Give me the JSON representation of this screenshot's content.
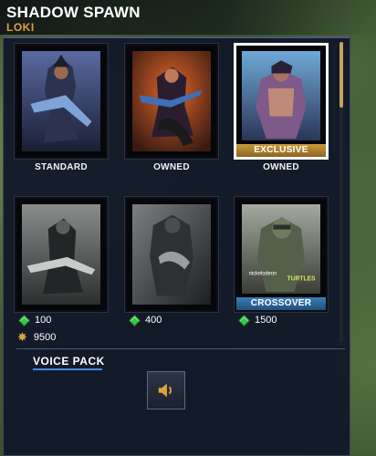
{
  "header": {
    "title": "SHADOW SPAWN",
    "god_name": "LOKI"
  },
  "skins": [
    {
      "status": "STANDARD",
      "ribbon": ""
    },
    {
      "status": "OWNED",
      "ribbon": ""
    },
    {
      "status": "OWNED",
      "ribbon": "EXCLUSIVE",
      "selected": true
    },
    {
      "status": "",
      "ribbon": "",
      "gems": "100",
      "favor": "9500"
    },
    {
      "status": "",
      "ribbon": "",
      "gems": "400"
    },
    {
      "status": "",
      "ribbon": "CROSSOVER",
      "gems": "1500",
      "art_text_1": "nickelodeon",
      "art_text_2": "TURTLES"
    }
  ],
  "voice_pack": {
    "label": "VOICE PACK",
    "icon": "speaker-icon"
  },
  "colors": {
    "accent_gold": "#d9a33b",
    "panel_bg": "#10162a",
    "gem_green": "#38c84a",
    "exclusive_ribbon": "#c99a3c",
    "crossover_ribbon": "#3b7fb6",
    "tab_underline": "#4d86e0"
  }
}
